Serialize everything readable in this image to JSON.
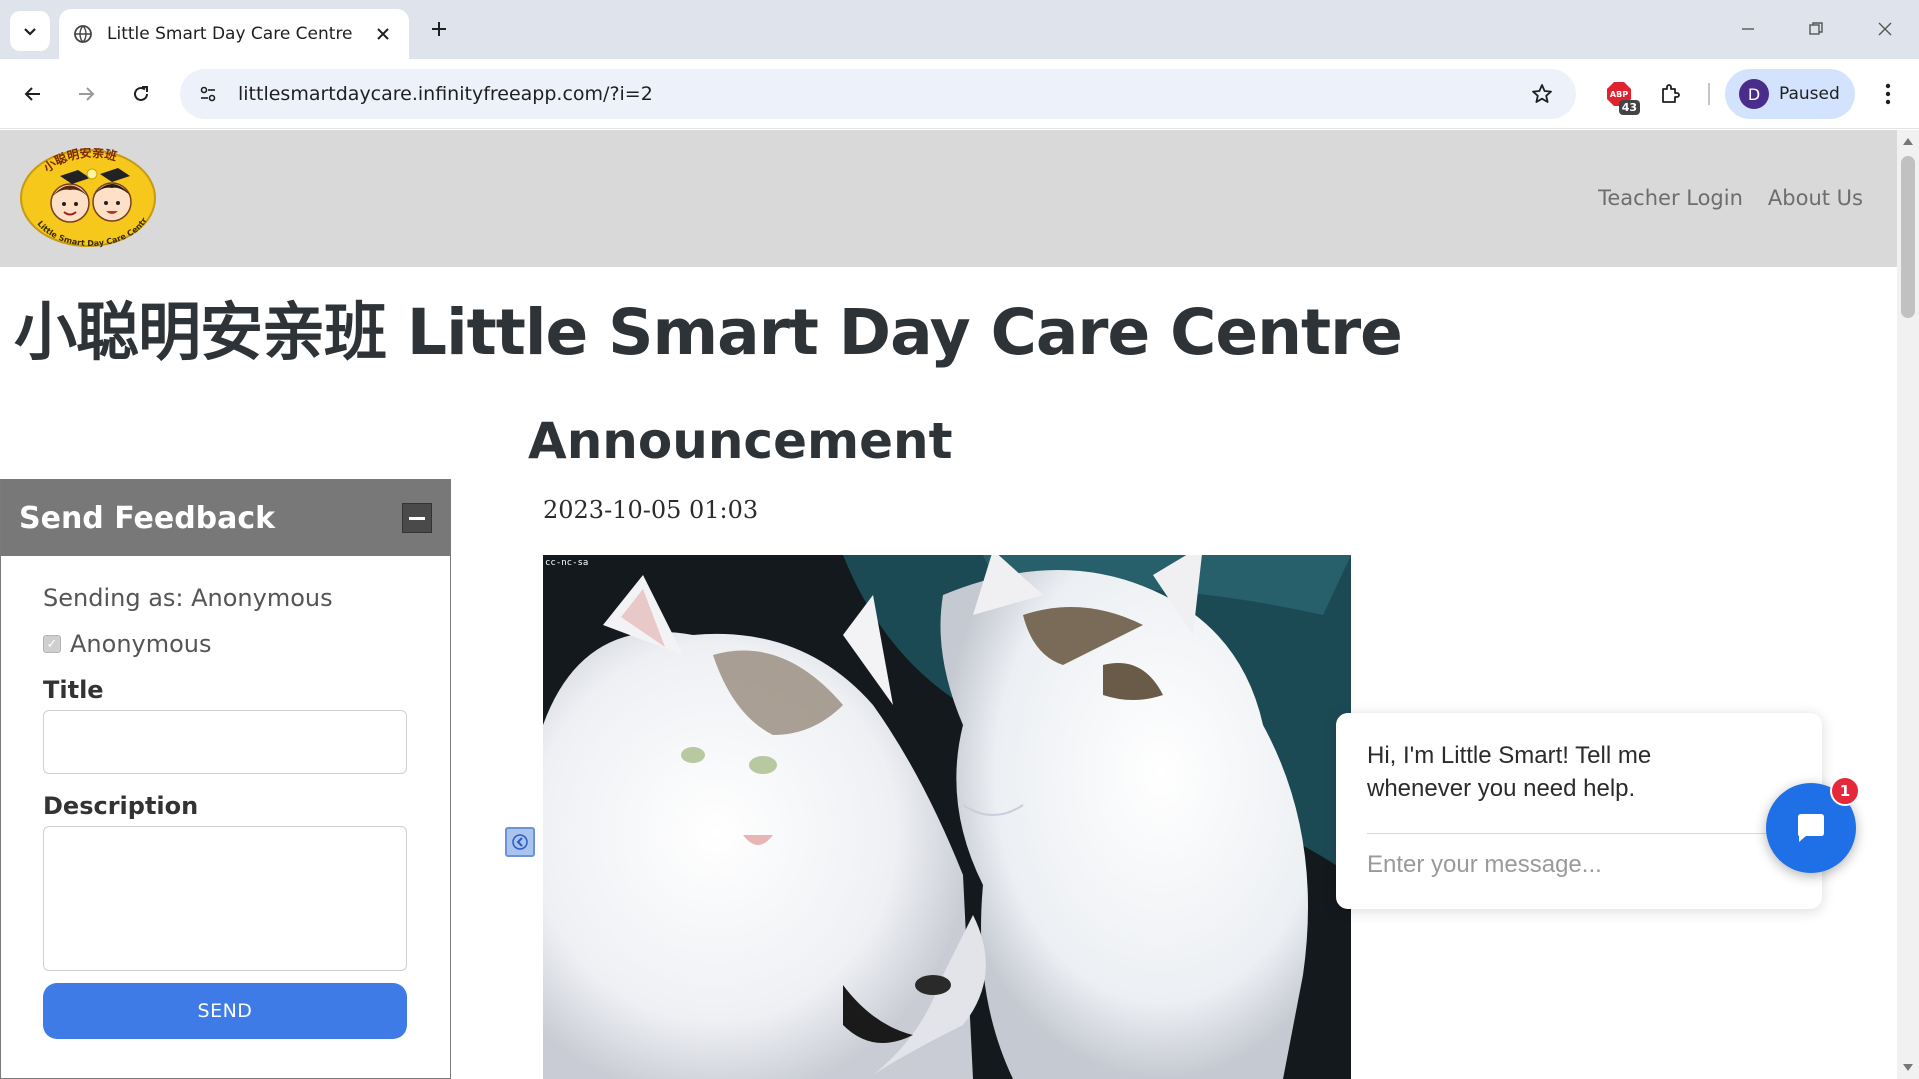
{
  "browser": {
    "tab_title": "Little Smart Day Care Centre",
    "url": "littlesmartdaycare.infinityfreeapp.com/?i=2",
    "extension_badge": "43",
    "profile_initial": "D",
    "profile_status": "Paused"
  },
  "site": {
    "logo_text": "小聪明安亲班",
    "logo_subtext": "Little Smart Day Care Centre",
    "nav": [
      "Teacher Login",
      "About Us"
    ],
    "page_title": "小聪明安亲班 Little Smart Day Care Centre"
  },
  "announcement": {
    "heading": "Announcement",
    "date": "2023-10-05 01:03",
    "image_tag": "cc-nc-sa"
  },
  "feedback": {
    "title": "Send Feedback",
    "sending_as": "Sending as: Anonymous",
    "anonymous_label": "Anonymous",
    "anonymous_checked": true,
    "title_label": "Title",
    "title_value": "",
    "description_label": "Description",
    "description_value": "",
    "send_label": "SEND"
  },
  "chat": {
    "greeting": "Hi, I'm Little Smart! Tell me whenever you need help.",
    "placeholder": "Enter your message...",
    "badge_count": "1"
  },
  "colors": {
    "header_bg": "#d9d9d9",
    "feedback_head": "#787878",
    "send_button": "#3e7be6",
    "chat_launcher": "#1f6fe6",
    "badge": "#e5293b"
  }
}
